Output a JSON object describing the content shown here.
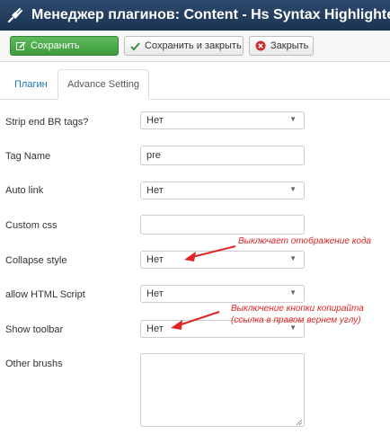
{
  "window": {
    "title": "Менеджер плагинов: Content - Hs Syntax Highlighter",
    "title_icon": "plug-icon"
  },
  "toolbar": {
    "save_label": "Сохранить",
    "save_close_label": "Сохранить и закрыть",
    "close_label": "Закрыть"
  },
  "tabs": [
    {
      "label": "Плагин",
      "active": false
    },
    {
      "label": "Advance Setting",
      "active": true
    }
  ],
  "fields": {
    "strip_br": {
      "label": "Strip end BR tags?",
      "value": "Нет"
    },
    "tag_name": {
      "label": "Tag Name",
      "value": "pre"
    },
    "auto_link": {
      "label": "Auto link",
      "value": "Нет"
    },
    "custom_css": {
      "label": "Custom css",
      "value": ""
    },
    "collapse_style": {
      "label": "Collapse style",
      "value": "Нет"
    },
    "allow_html": {
      "label": "allow HTML Script",
      "value": "Нет"
    },
    "show_toolbar": {
      "label": "Show toolbar",
      "value": "Нет"
    },
    "other_brushs": {
      "label": "Other brushs",
      "value": ""
    }
  },
  "annotations": {
    "collapse_note": "Выключает отображение кода",
    "toolbar_note_line1": "Выключение кнопки копирайта",
    "toolbar_note_line2": "(ссылка в правом вернем углу)"
  },
  "colors": {
    "titlebar": "#1f3a5c",
    "save_button": "#46a546",
    "link": "#1a73b5",
    "annotation": "#e02424"
  }
}
